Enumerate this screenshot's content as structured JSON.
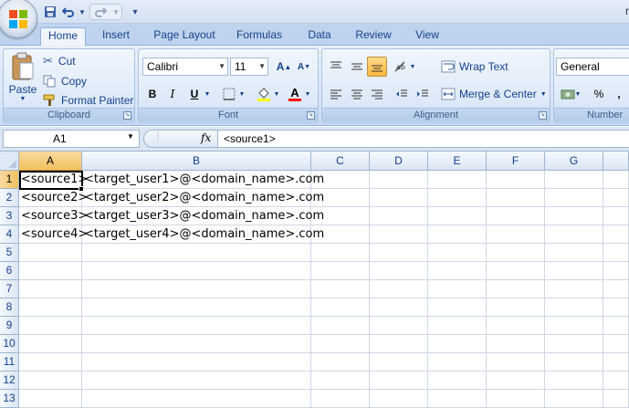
{
  "window": {
    "title_fragment": "r"
  },
  "quick_access": {
    "customize_glyph": "▾"
  },
  "tabs": [
    {
      "label": "Home",
      "active": true
    },
    {
      "label": "Insert"
    },
    {
      "label": "Page Layout"
    },
    {
      "label": "Formulas"
    },
    {
      "label": "Data"
    },
    {
      "label": "Review"
    },
    {
      "label": "View"
    }
  ],
  "clipboard": {
    "paste_label": "Paste",
    "cut_label": "Cut",
    "copy_label": "Copy",
    "format_painter_label": "Format Painter",
    "group_label": "Clipboard"
  },
  "font": {
    "font_name": "Calibri",
    "font_size": "11",
    "group_label": "Font",
    "bold": "B",
    "italic": "I",
    "underline": "U",
    "fill_color": "#ffff00",
    "font_color": "#ff0000"
  },
  "alignment": {
    "wrap_text_label": "Wrap Text",
    "merge_center_label": "Merge & Center",
    "group_label": "Alignment"
  },
  "number": {
    "format_value": "General",
    "percent": "%",
    "comma": ",",
    "group_label": "Number"
  },
  "formula_bar": {
    "name_box": "A1",
    "fx_label": "fx",
    "content": "<source1>"
  },
  "sheet": {
    "columns": [
      "A",
      "B",
      "C",
      "D",
      "E",
      "F",
      "G"
    ],
    "selected_column": "A",
    "rows": [
      "1",
      "2",
      "3",
      "4",
      "5",
      "6",
      "7",
      "8",
      "9",
      "10",
      "11",
      "12",
      "13"
    ],
    "selected_row": "1",
    "cells": {
      "A1": "<source1>",
      "B1": "<target_user1>@<domain_name>.com",
      "A2": "<source2>",
      "B2": "<target_user2>@<domain_name>.com",
      "A3": "<source3>",
      "B3": "<target_user3>@<domain_name>.com",
      "A4": "<source4>",
      "B4": "<target_user4>@<domain_name>.com"
    },
    "active_cell": "A1"
  }
}
